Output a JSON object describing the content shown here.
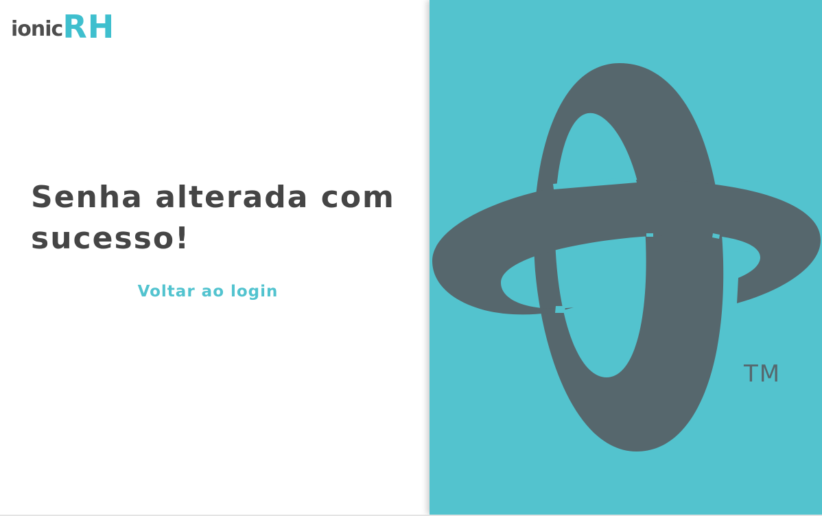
{
  "brand": {
    "logo_prefix": "ionic",
    "logo_suffix": "RH",
    "trademark": "TM"
  },
  "main": {
    "title": "Senha alterada com sucesso!",
    "back_link": "Voltar ao login"
  },
  "colors": {
    "accent": "#53c3ce",
    "title_text": "#454545",
    "logo_gray": "#4d4d4d",
    "mark_gray": "#56676d",
    "link": "#52c3cf"
  },
  "icons": {
    "brand_mark": "ionic-orbit-logo-icon"
  }
}
